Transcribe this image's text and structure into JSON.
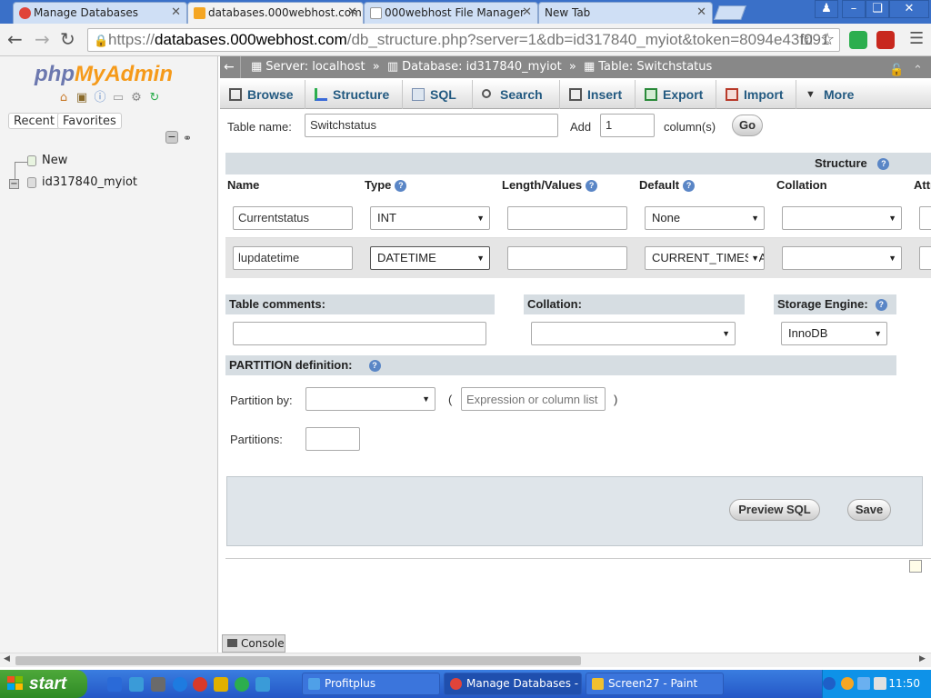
{
  "browser": {
    "tabs": [
      {
        "label": "Manage Databases",
        "icon_color": "#e0443a"
      },
      {
        "label": "databases.000webhost.com",
        "icon_color": "#f5a623"
      },
      {
        "label": "000webhost File Manager",
        "icon_color": "#ffffff"
      },
      {
        "label": "New Tab",
        "icon_color": "#cfdff5"
      }
    ],
    "close_glyph": "✕",
    "url_scheme": "https://",
    "url_host": "databases.000webhost.com",
    "url_rest": "/db_structure.php?server=1&db=id317840_myiot&token=8094e43f091",
    "extension_colors": [
      "#2cae4e",
      "#c8281e",
      "#555555"
    ]
  },
  "pma": {
    "logo": {
      "php": "php",
      "my": "My",
      "admin": "Admin"
    },
    "quick_icons": [
      "home-icon",
      "logout-icon",
      "help-icon",
      "docs-icon",
      "settings-icon",
      "reload-icon"
    ],
    "recent_label": "Recent",
    "favorites_label": "Favorites",
    "tree": {
      "new_label": "New",
      "db_label": "id317840_myiot"
    }
  },
  "breadcrumb": {
    "server": "Server: localhost",
    "database": "Database: id317840_myiot",
    "table": "Table: Switchstatus",
    "separator": "»"
  },
  "menu_tabs": [
    {
      "label": "Browse",
      "icon": "browse-icon"
    },
    {
      "label": "Structure",
      "icon": "structure-icon"
    },
    {
      "label": "SQL",
      "icon": "sql-icon"
    },
    {
      "label": "Search",
      "icon": "search-icon"
    },
    {
      "label": "Insert",
      "icon": "insert-icon"
    },
    {
      "label": "Export",
      "icon": "export-icon"
    },
    {
      "label": "Import",
      "icon": "import-icon"
    },
    {
      "label": "More",
      "icon": "more-icon"
    }
  ],
  "form": {
    "table_name_label": "Table name:",
    "table_name_value": "Switchstatus",
    "add_label": "Add",
    "add_value": "1",
    "columns_label": "column(s)",
    "go_label": "Go",
    "structure_title": "Structure",
    "headers": {
      "name": "Name",
      "type": "Type",
      "length": "Length/Values",
      "default": "Default",
      "collation": "Collation",
      "attributes": "Attri"
    },
    "rows": [
      {
        "name": "Currentstatus",
        "type": "INT",
        "length": "",
        "default": "None",
        "collation": ""
      },
      {
        "name": "lupdatetime",
        "type": "DATETIME",
        "length": "",
        "default": "CURRENT_TIMESTAMP",
        "collation": ""
      }
    ],
    "table_comments_label": "Table comments:",
    "collation_label": "Collation:",
    "storage_engine_label": "Storage Engine:",
    "storage_engine_value": "InnoDB",
    "partition_definition_label": "PARTITION definition:",
    "partition_by_label": "Partition by:",
    "partition_by_value": "",
    "open_paren": "(",
    "close_paren": ")",
    "expression_placeholder": "Expression or column list",
    "partitions_label": "Partitions:",
    "partitions_value": "",
    "preview_sql_label": "Preview SQL",
    "save_label": "Save",
    "console_label": "Console"
  },
  "taskbar": {
    "start_label": "start",
    "quicklaunch_colors": [
      "#2a6ad8",
      "#3a9bd8",
      "#6a6a6a",
      "#1e7be0",
      "#d83a2a",
      "#e0b000",
      "#2cae4e",
      "#3a9bd8"
    ],
    "buttons": [
      {
        "label": "Profitplus",
        "icon_color": "#4fa0e8"
      },
      {
        "label": "Manage Databases - ...",
        "icon_color": "#e0443a"
      },
      {
        "label": "Screen27 - Paint",
        "icon_color": "#f0c030"
      }
    ],
    "tray_colors": [
      "#1e5fc8",
      "#f5a623",
      "#6ab0f0",
      "#e0e0e0"
    ],
    "clock": "11:50"
  }
}
